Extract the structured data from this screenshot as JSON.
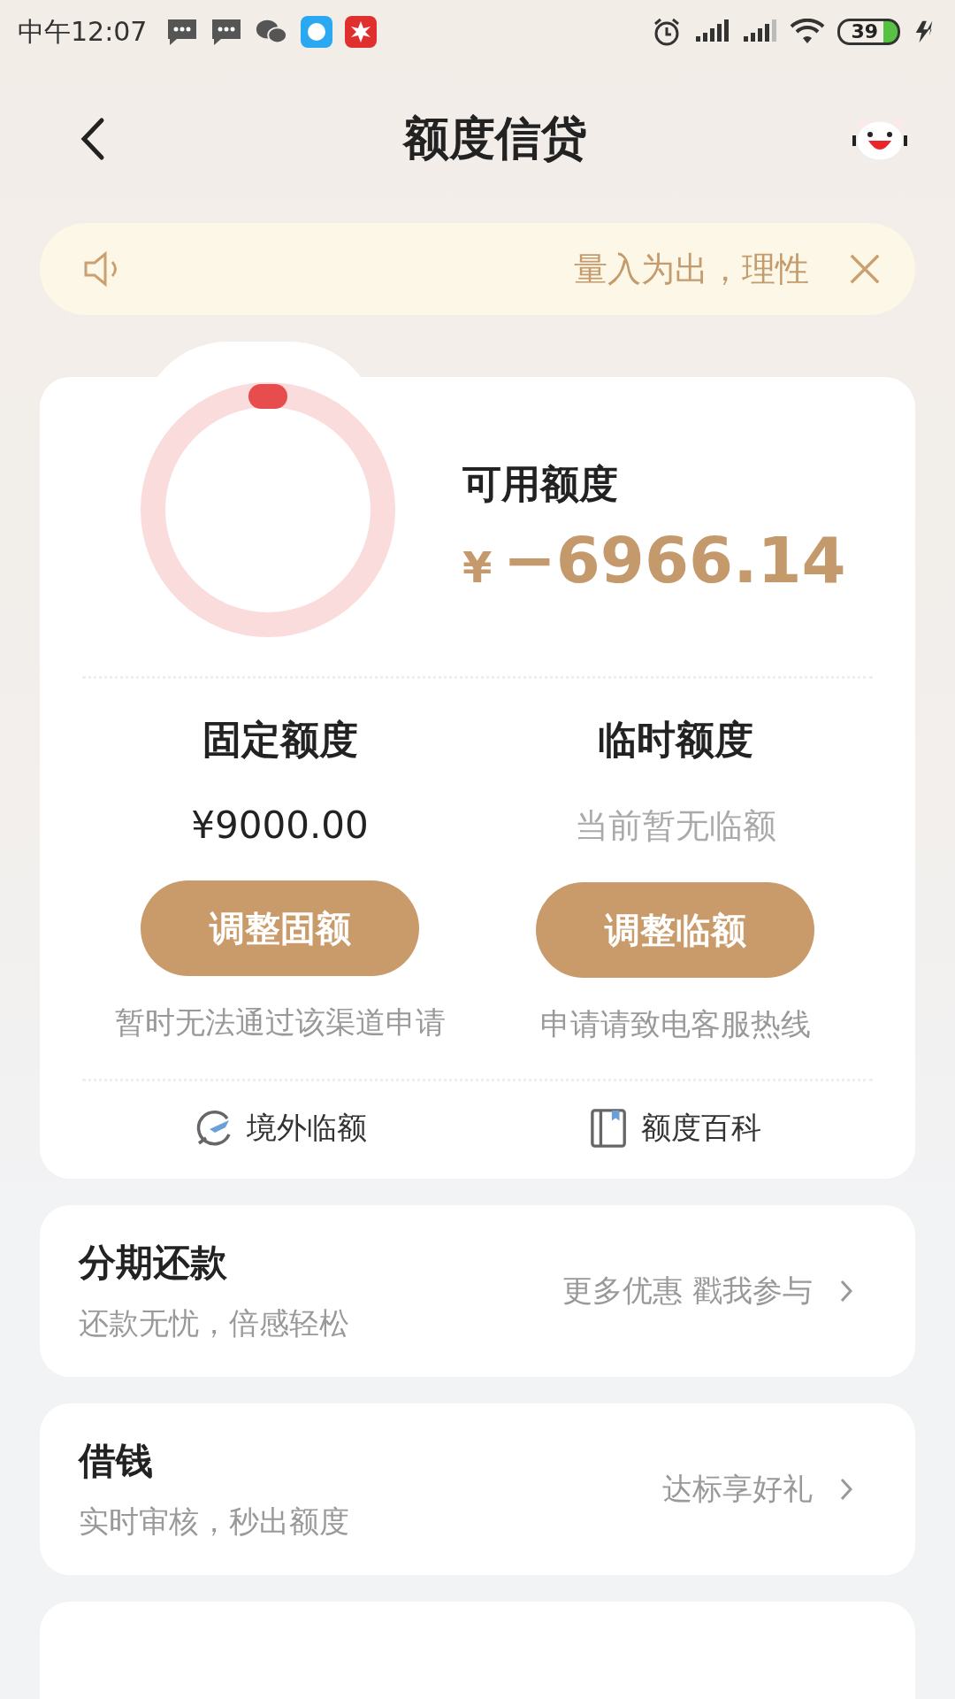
{
  "status_bar": {
    "time": "中午12:07",
    "battery": "39"
  },
  "header": {
    "title": "额度信贷"
  },
  "notice": {
    "text": "量入为出，理性"
  },
  "credit": {
    "label": "可用额度",
    "currency": "¥",
    "amount": "−6966.14"
  },
  "quotas": [
    {
      "title": "固定额度",
      "value": "¥9000.00",
      "muted": false,
      "button": "调整固额",
      "note": "暂时无法通过该渠道申请"
    },
    {
      "title": "临时额度",
      "value": "当前暂无临额",
      "muted": true,
      "button": "调整临额",
      "note": "申请请致电客服热线"
    }
  ],
  "links": [
    {
      "kind": "travel",
      "label": "境外临额"
    },
    {
      "kind": "book",
      "label": "额度百科"
    }
  ],
  "services": [
    {
      "title": "分期还款",
      "subtitle": "还款无忧，倍感轻松",
      "promo": "更多优惠 戳我参与"
    },
    {
      "title": "借钱",
      "subtitle": "实时审核，秒出额度",
      "promo": "达标享好礼"
    }
  ]
}
